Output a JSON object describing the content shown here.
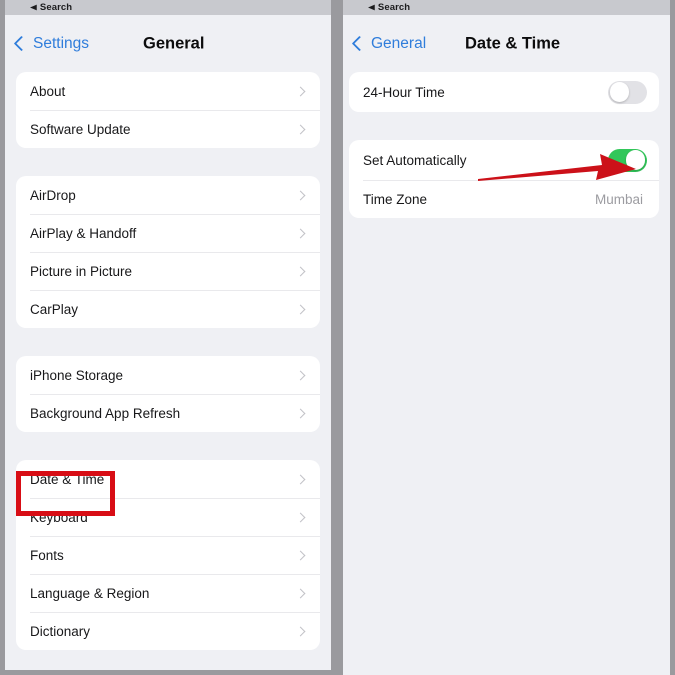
{
  "screens": [
    {
      "id": "general-settings",
      "statusbar": {
        "back_glyph": "◀",
        "back_label": "Search"
      },
      "navbar": {
        "back_label": "Settings",
        "title": "General",
        "back_icon": "chevron-left-icon"
      },
      "groups": [
        {
          "rows": [
            {
              "label": "About",
              "accessory": "chevron-right-icon"
            },
            {
              "label": "Software Update",
              "accessory": "chevron-right-icon"
            }
          ]
        },
        {
          "rows": [
            {
              "label": "AirDrop",
              "accessory": "chevron-right-icon"
            },
            {
              "label": "AirPlay & Handoff",
              "accessory": "chevron-right-icon"
            },
            {
              "label": "Picture in Picture",
              "accessory": "chevron-right-icon"
            },
            {
              "label": "CarPlay",
              "accessory": "chevron-right-icon"
            }
          ]
        },
        {
          "rows": [
            {
              "label": "iPhone Storage",
              "accessory": "chevron-right-icon"
            },
            {
              "label": "Background App Refresh",
              "accessory": "chevron-right-icon"
            }
          ]
        },
        {
          "rows": [
            {
              "label": "Date & Time",
              "accessory": "chevron-right-icon",
              "highlighted": true
            },
            {
              "label": "Keyboard",
              "accessory": "chevron-right-icon"
            },
            {
              "label": "Fonts",
              "accessory": "chevron-right-icon"
            },
            {
              "label": "Language & Region",
              "accessory": "chevron-right-icon"
            },
            {
              "label": "Dictionary",
              "accessory": "chevron-right-icon"
            }
          ]
        }
      ]
    },
    {
      "id": "date-and-time-settings",
      "statusbar": {
        "back_glyph": "◀",
        "back_label": "Search"
      },
      "navbar": {
        "back_label": "General",
        "title": "Date & Time",
        "back_icon": "chevron-left-icon"
      },
      "groups": [
        {
          "rows": [
            {
              "label": "24-Hour Time",
              "accessory": "toggle",
              "toggle_state": "off"
            }
          ]
        },
        {
          "rows": [
            {
              "label": "Set Automatically",
              "accessory": "toggle",
              "toggle_state": "on"
            },
            {
              "label": "Time Zone",
              "value": "Mumbai"
            }
          ]
        }
      ]
    }
  ],
  "annotations": {
    "highlight_color": "#d80d15",
    "arrow_color": "#cc1119",
    "highlight_target": "Date & Time",
    "arrow_target": "Set Automatically toggle"
  }
}
